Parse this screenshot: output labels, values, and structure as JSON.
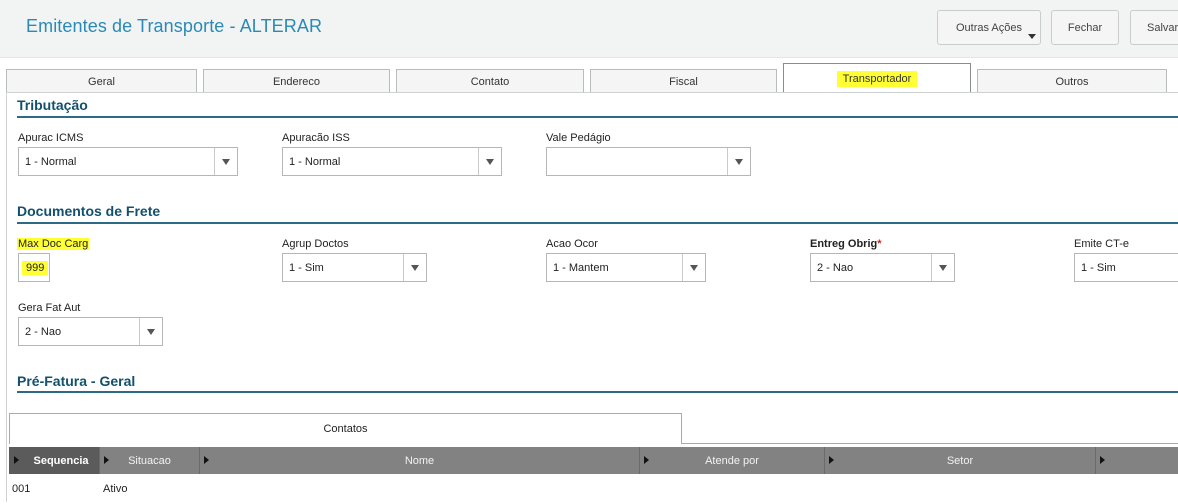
{
  "header": {
    "title": "Emitentes de Transporte - ALTERAR",
    "buttons": {
      "outras_acoes": "Outras Ações",
      "fechar": "Fechar",
      "salvar": "Salvar"
    }
  },
  "tabs": [
    "Geral",
    "Endereco",
    "Contato",
    "Fiscal",
    "Transportador",
    "Outros"
  ],
  "active_tab": "Transportador",
  "tributacao": {
    "title": "Tributação",
    "apurac_icms": {
      "label": "Apurac ICMS",
      "value": "1 - Normal"
    },
    "apuracao_iss": {
      "label": "Apuracão ISS",
      "value": "1 - Normal"
    },
    "vale_pedagio": {
      "label": "Vale Pedágio",
      "value": ""
    }
  },
  "documentos": {
    "title": "Documentos de Frete",
    "max_doc_carg": {
      "label": "Max Doc Carg",
      "value": "999"
    },
    "agrup_doctos": {
      "label": "Agrup Doctos",
      "value": "1 - Sim"
    },
    "acao_ocor": {
      "label": "Acao Ocor",
      "value": "1 - Mantem"
    },
    "entreg_obrig": {
      "label": "Entreg Obrig",
      "required_mark": "*",
      "value": "2 - Nao"
    },
    "emite_cte": {
      "label": "Emite CT-e",
      "value": "1 - Sim"
    },
    "gera_fat_aut": {
      "label": "Gera Fat Aut",
      "value": "2 - Nao"
    }
  },
  "pre_fatura": {
    "title": "Pré-Fatura - Geral"
  },
  "grid": {
    "tab_label": "Contatos",
    "columns": [
      "Sequencia",
      "Situacao",
      "Nome",
      "Atende por",
      "Setor"
    ],
    "rows": [
      {
        "sequencia": "001",
        "situacao": "Ativo"
      }
    ]
  },
  "colors": {
    "title": "#2a8ab5",
    "section": "#12506d",
    "highlight": "#ffff33",
    "grid_header": "#828282"
  }
}
